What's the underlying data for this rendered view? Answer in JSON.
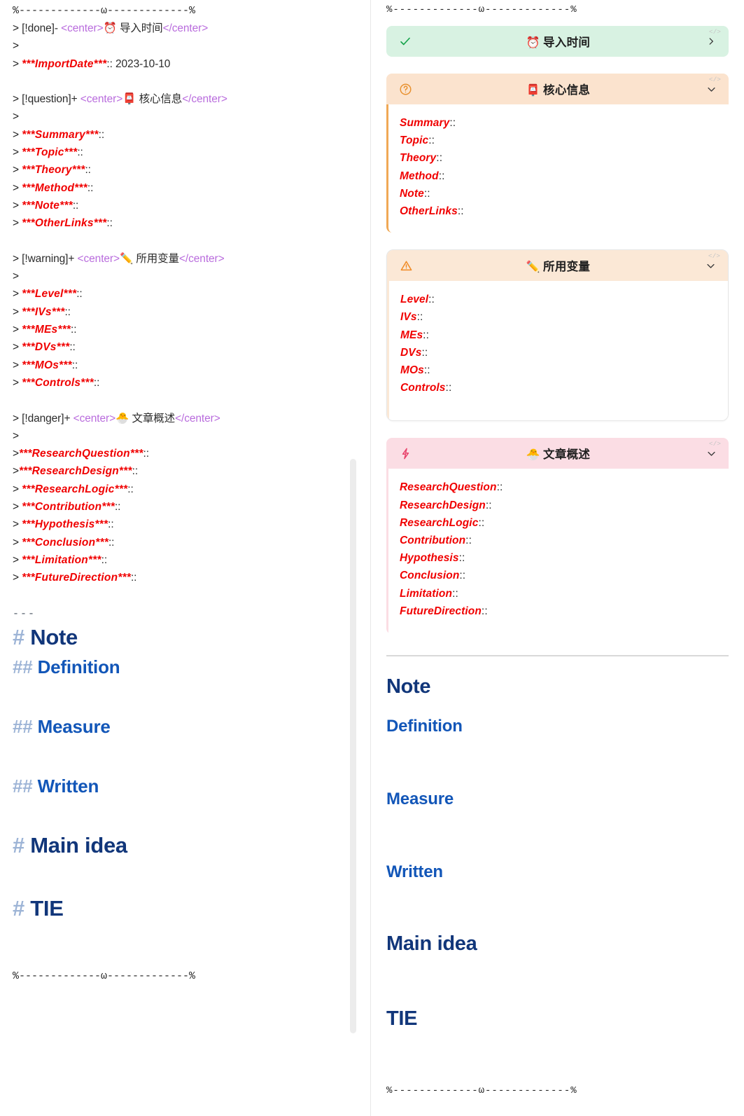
{
  "app": {
    "type": "markdown-editor-split-view",
    "panes": [
      "source-edit",
      "rendered-preview"
    ]
  },
  "colors": {
    "callout_done_bg": "#d8f2e2",
    "callout_done_icon": "#15a34a",
    "callout_question_bg": "#fbe3ce",
    "callout_question_icon": "#e8912f",
    "callout_warning_bg": "#fbe8d6",
    "callout_warning_icon": "#f08a24",
    "callout_danger_bg": "#fbdde4",
    "callout_danger_icon": "#e8436b",
    "bold_red": "#f00000",
    "heading_h1": "#11367a",
    "heading_h2": "#1256b8",
    "hash_marker": "#9db4d6",
    "html_tag": "#b96cdd",
    "body_text": "#2b2b2b",
    "scrollbar_thumb": "#ececec",
    "pane_divider": "#e8e8e8"
  },
  "divider_rule": "%-------------ω-------------%",
  "source": {
    "lines": [
      {
        "kind": "rule",
        "text": "%-------------ω-------------%"
      },
      {
        "kind": "callout_head",
        "quote": ">",
        "marker": "[!done]-",
        "open_tag": "<center>",
        "emoji": "⏰",
        "title": "导入时间",
        "close_tag": "</center>"
      },
      {
        "kind": "quote_blank",
        "quote": ">"
      },
      {
        "kind": "kv",
        "quote": ">",
        "key": "***ImportDate***",
        "colons": "::",
        "value": " 2023-10-10"
      },
      {
        "kind": "blank"
      },
      {
        "kind": "callout_head",
        "quote": ">",
        "marker": "[!question]+",
        "open_tag": "<center>",
        "emoji": "📮",
        "title": "核心信息",
        "close_tag": "</center>"
      },
      {
        "kind": "quote_blank",
        "quote": ">"
      },
      {
        "kind": "kv",
        "quote": ">",
        "key": "***Summary***",
        "colons": "::",
        "value": ""
      },
      {
        "kind": "kv",
        "quote": ">",
        "key": "***Topic***",
        "colons": "::",
        "value": ""
      },
      {
        "kind": "kv",
        "quote": ">",
        "key": "***Theory***",
        "colons": "::",
        "value": ""
      },
      {
        "kind": "kv",
        "quote": ">",
        "key": "***Method***",
        "colons": "::",
        "value": ""
      },
      {
        "kind": "kv",
        "quote": ">",
        "key": "***Note***",
        "colons": "::",
        "value": ""
      },
      {
        "kind": "kv",
        "quote": ">",
        "key": "***OtherLinks***",
        "colons": "::",
        "value": ""
      },
      {
        "kind": "blank"
      },
      {
        "kind": "callout_head",
        "quote": ">",
        "marker": "[!warning]+",
        "open_tag": "<center>",
        "emoji": "✏️",
        "title": "所用变量",
        "close_tag": "</center>"
      },
      {
        "kind": "quote_blank",
        "quote": ">"
      },
      {
        "kind": "kv",
        "quote": ">",
        "key": "***Level***",
        "colons": "::",
        "value": ""
      },
      {
        "kind": "kv",
        "quote": ">",
        "key": "***IVs***",
        "colons": "::",
        "value": ""
      },
      {
        "kind": "kv",
        "quote": ">",
        "key": "***MEs***",
        "colons": "::",
        "value": ""
      },
      {
        "kind": "kv",
        "quote": ">",
        "key": "***DVs***",
        "colons": "::",
        "value": ""
      },
      {
        "kind": "kv",
        "quote": ">",
        "key": "***MOs***",
        "colons": "::",
        "value": ""
      },
      {
        "kind": "kv",
        "quote": ">",
        "key": "***Controls***",
        "colons": "::",
        "value": ""
      },
      {
        "kind": "blank"
      },
      {
        "kind": "callout_head",
        "quote": ">",
        "marker": "[!danger]+",
        "open_tag": "<center>",
        "emoji": "🐣",
        "title": "文章概述",
        "close_tag": "</center>"
      },
      {
        "kind": "quote_blank",
        "quote": ">"
      },
      {
        "kind": "kv",
        "quote": ">",
        "key": "***ResearchQuestion***",
        "colons": "::",
        "value": ""
      },
      {
        "kind": "kv",
        "quote": ">",
        "key": "***ResearchDesign***",
        "colons": "::",
        "value": ""
      },
      {
        "kind": "kv",
        "quote": ">",
        "key": "***ResearchLogic***",
        "colons": "::",
        "value": ""
      },
      {
        "kind": "kv",
        "quote": ">",
        "key": "***Contribution***",
        "colons": "::",
        "value": ""
      },
      {
        "kind": "kv",
        "quote": ">",
        "key": "***Hypothesis***",
        "colons": "::",
        "value": ""
      },
      {
        "kind": "kv",
        "quote": ">",
        "key": "***Conclusion***",
        "colons": "::",
        "value": ""
      },
      {
        "kind": "kv",
        "quote": ">",
        "key": "***Limitation***",
        "colons": "::",
        "value": ""
      },
      {
        "kind": "kv",
        "quote": ">",
        "key": "***FutureDirection***",
        "colons": "::",
        "value": ""
      }
    ],
    "horizontal_rule_marker": "---",
    "headings": [
      {
        "level": 1,
        "hash": "#",
        "text": "Note"
      },
      {
        "level": 2,
        "hash": "##",
        "text": "Definition"
      },
      {
        "level": 2,
        "hash": "##",
        "text": "Measure"
      },
      {
        "level": 2,
        "hash": "##",
        "text": "Written"
      },
      {
        "level": 1,
        "hash": "#",
        "text": "Main idea"
      },
      {
        "level": 1,
        "hash": "#",
        "text": "TIE"
      }
    ],
    "footer_rule": "%-------------ω-------------%"
  },
  "preview": {
    "top_rule": "%-------------ω-------------%",
    "bottom_rule": "%-------------ω-------------%",
    "code_hint": "</>",
    "callouts": [
      {
        "type": "done",
        "icon": "check-icon",
        "emoji": "⏰",
        "title": "导入时间",
        "collapsed": true,
        "fold_glyph": "›",
        "items": []
      },
      {
        "type": "question",
        "icon": "question-circle-icon",
        "emoji": "📮",
        "title": "核心信息",
        "collapsed": false,
        "fold_glyph": "⌄",
        "items": [
          {
            "key": "Summary",
            "colons": "::"
          },
          {
            "key": "Topic",
            "colons": "::"
          },
          {
            "key": "Theory",
            "colons": "::"
          },
          {
            "key": "Method",
            "colons": "::"
          },
          {
            "key": "Note",
            "colons": "::"
          },
          {
            "key": "OtherLinks",
            "colons": "::"
          }
        ]
      },
      {
        "type": "warning",
        "icon": "warning-triangle-icon",
        "emoji": "✏️",
        "title": "所用变量",
        "collapsed": false,
        "fold_glyph": "⌄",
        "items": [
          {
            "key": "Level",
            "colons": "::"
          },
          {
            "key": "IVs",
            "colons": "::"
          },
          {
            "key": "MEs",
            "colons": "::"
          },
          {
            "key": "DVs",
            "colons": "::"
          },
          {
            "key": "MOs",
            "colons": "::"
          },
          {
            "key": "Controls",
            "colons": "::"
          }
        ]
      },
      {
        "type": "danger",
        "icon": "lightning-bolt-icon",
        "emoji": "🐣",
        "title": "文章概述",
        "collapsed": false,
        "fold_glyph": "⌄",
        "items": [
          {
            "key": "ResearchQuestion",
            "colons": "::"
          },
          {
            "key": "ResearchDesign",
            "colons": "::"
          },
          {
            "key": "ResearchLogic",
            "colons": "::"
          },
          {
            "key": "Contribution",
            "colons": "::"
          },
          {
            "key": "Hypothesis",
            "colons": "::"
          },
          {
            "key": "Conclusion",
            "colons": "::"
          },
          {
            "key": "Limitation",
            "colons": "::"
          },
          {
            "key": "FutureDirection",
            "colons": "::"
          }
        ]
      }
    ],
    "headings": [
      {
        "level": 1,
        "text": "Note"
      },
      {
        "level": 2,
        "text": "Definition"
      },
      {
        "level": 2,
        "text": "Measure"
      },
      {
        "level": 2,
        "text": "Written"
      },
      {
        "level": 1,
        "text": "Main idea"
      },
      {
        "level": 1,
        "text": "TIE"
      }
    ]
  }
}
